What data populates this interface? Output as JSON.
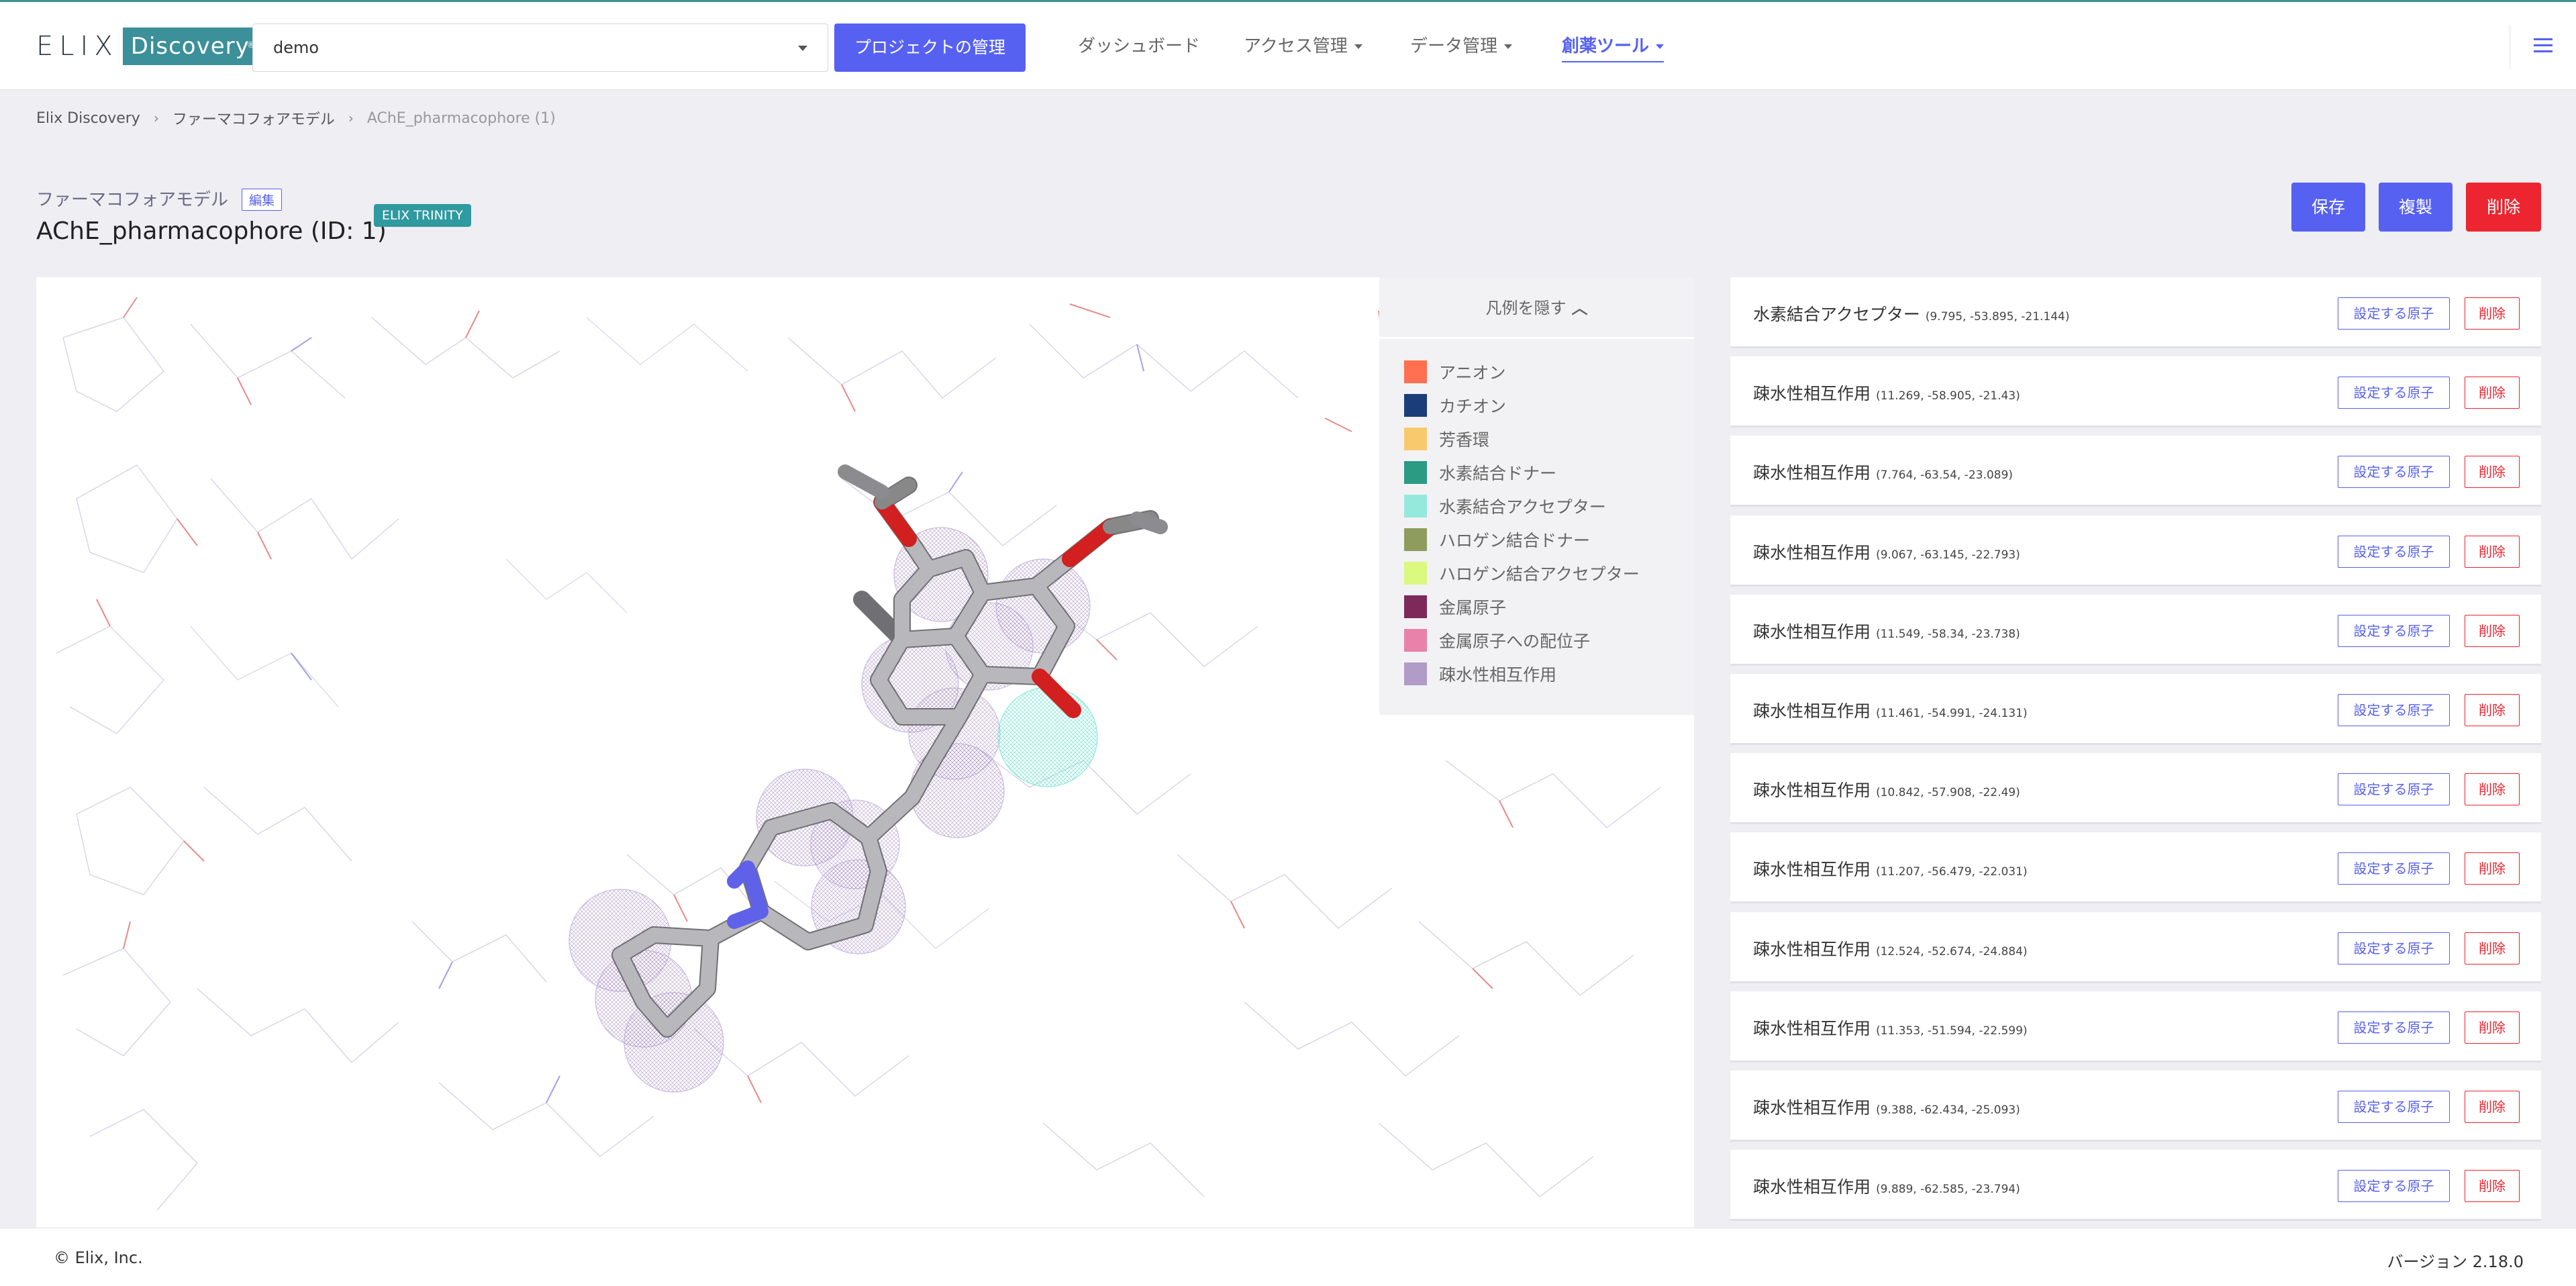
{
  "header": {
    "logo_text": "ELIX",
    "logo_badge": "Discovery",
    "project_value": "demo",
    "manage_button": "プロジェクトの管理",
    "nav": [
      {
        "label": "ダッシュボード"
      },
      {
        "label": "アクセス管理"
      },
      {
        "label": "データ管理"
      },
      {
        "label": "創薬ツール"
      }
    ]
  },
  "breadcrumb": {
    "root": "Elix Discovery",
    "section": "ファーマコフォアモデル",
    "current": "AChE_pharmacophore (1)"
  },
  "page": {
    "model_type": "ファーマコフォアモデル",
    "edit_tag": "編集",
    "title": "AChE_pharmacophore (ID: 1)",
    "badge": "ELIX TRINITY",
    "save_button": "保存",
    "copy_button": "複製",
    "delete_button": "削除"
  },
  "legend": {
    "toggle_label": "凡例を隠す",
    "items": [
      {
        "label": "アニオン",
        "color": "#ff6f50"
      },
      {
        "label": "カチオン",
        "color": "#1b3d7a"
      },
      {
        "label": "芳香環",
        "color": "#f9c96e"
      },
      {
        "label": "水素結合ドナー",
        "color": "#2b9b84"
      },
      {
        "label": "水素結合アクセプター",
        "color": "#95e8dc"
      },
      {
        "label": "ハロゲン結合ドナー",
        "color": "#8e9c5e"
      },
      {
        "label": "ハロゲン結合アクセプター",
        "color": "#d9f97f"
      },
      {
        "label": "金属原子",
        "color": "#7d2a5a"
      },
      {
        "label": "金属原子への配位子",
        "color": "#e882aa"
      },
      {
        "label": "疎水性相互作用",
        "color": "#b19cc8"
      }
    ]
  },
  "features": [
    {
      "name": "水素結合アクセプター",
      "coords": "(9.795, -53.895, -21.144)",
      "atoms_button": "設定する原子",
      "delete_button": "削除"
    },
    {
      "name": "疎水性相互作用",
      "coords": "(11.269, -58.905, -21.43)",
      "atoms_button": "設定する原子",
      "delete_button": "削除"
    },
    {
      "name": "疎水性相互作用",
      "coords": "(7.764, -63.54, -23.089)",
      "atoms_button": "設定する原子",
      "delete_button": "削除"
    },
    {
      "name": "疎水性相互作用",
      "coords": "(9.067, -63.145, -22.793)",
      "atoms_button": "設定する原子",
      "delete_button": "削除"
    },
    {
      "name": "疎水性相互作用",
      "coords": "(11.549, -58.34, -23.738)",
      "atoms_button": "設定する原子",
      "delete_button": "削除"
    },
    {
      "name": "疎水性相互作用",
      "coords": "(11.461, -54.991, -24.131)",
      "atoms_button": "設定する原子",
      "delete_button": "削除"
    },
    {
      "name": "疎水性相互作用",
      "coords": "(10.842, -57.908, -22.49)",
      "atoms_button": "設定する原子",
      "delete_button": "削除"
    },
    {
      "name": "疎水性相互作用",
      "coords": "(11.207, -56.479, -22.031)",
      "atoms_button": "設定する原子",
      "delete_button": "削除"
    },
    {
      "name": "疎水性相互作用",
      "coords": "(12.524, -52.674, -24.884)",
      "atoms_button": "設定する原子",
      "delete_button": "削除"
    },
    {
      "name": "疎水性相互作用",
      "coords": "(11.353, -51.594, -22.599)",
      "atoms_button": "設定する原子",
      "delete_button": "削除"
    },
    {
      "name": "疎水性相互作用",
      "coords": "(9.388, -62.434, -25.093)",
      "atoms_button": "設定する原子",
      "delete_button": "削除"
    },
    {
      "name": "疎水性相互作用",
      "coords": "(9.889, -62.585, -23.794)",
      "atoms_button": "設定する原子",
      "delete_button": "削除"
    }
  ],
  "footer": {
    "copyright": "© Elix, Inc.",
    "version": "バージョン 2.18.0"
  }
}
